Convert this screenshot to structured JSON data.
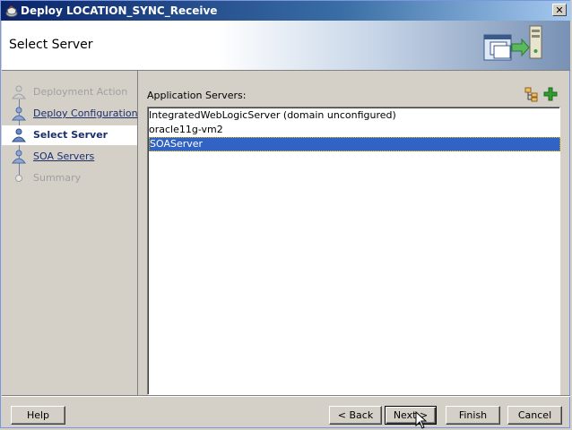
{
  "window": {
    "title": "Deploy LOCATION_SYNC_Receive",
    "close_label": "✕"
  },
  "header": {
    "page_title": "Select Server"
  },
  "nav": {
    "items": [
      {
        "label": "Deployment Action",
        "state": "disabled"
      },
      {
        "label": "Deploy Configuration",
        "state": "link"
      },
      {
        "label": "Select Server",
        "state": "active"
      },
      {
        "label": "SOA Servers",
        "state": "link"
      },
      {
        "label": "Summary",
        "state": "disabled"
      }
    ]
  },
  "main": {
    "servers_label": "Application Servers:",
    "servers": [
      {
        "name": "IntegratedWebLogicServer (domain unconfigured)",
        "selected": false
      },
      {
        "name": "oracle11g-vm2",
        "selected": false
      },
      {
        "name": "SOAServer",
        "selected": true
      }
    ]
  },
  "footer": {
    "help": "Help",
    "back": "< Back",
    "next": "Next >",
    "finish": "Finish",
    "cancel": "Cancel"
  },
  "colors": {
    "title_bar": "#0a246a",
    "selection": "#3163c4",
    "nav_link": "#1c2f6b",
    "add_icon": "#2e9d2e"
  }
}
